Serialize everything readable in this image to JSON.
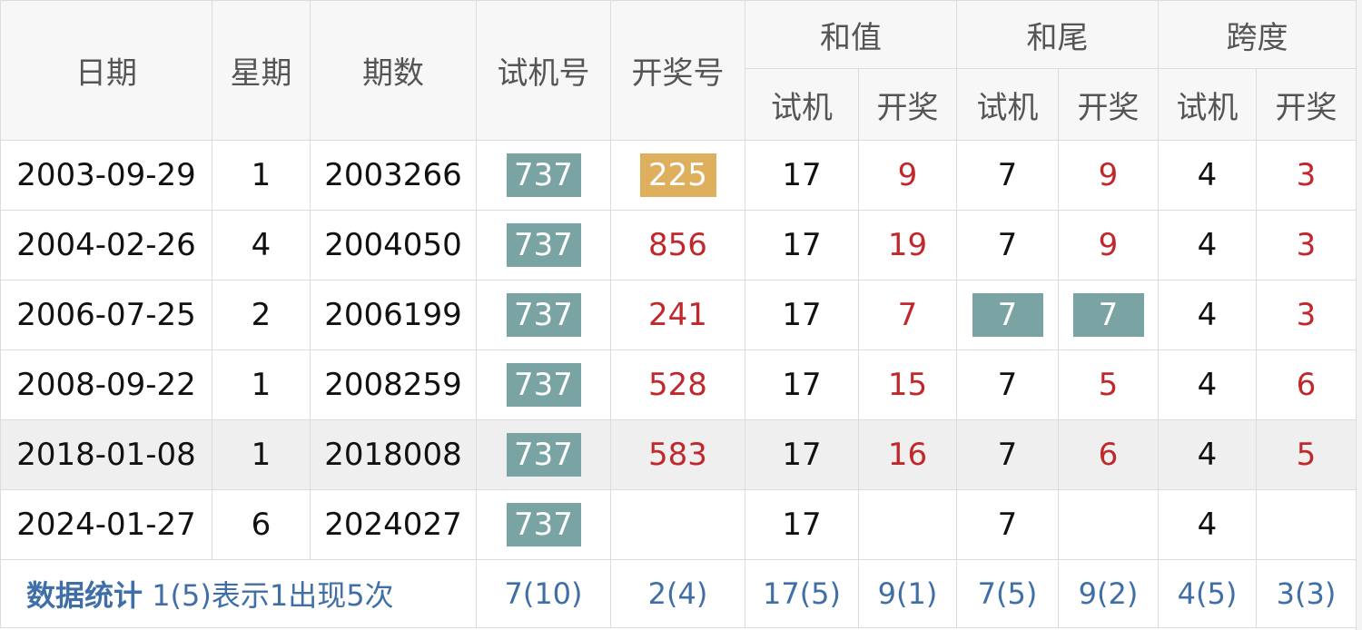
{
  "headers": {
    "date": "日期",
    "weekday": "星期",
    "issue": "期数",
    "test_number": "试机号",
    "draw_number": "开奖号",
    "sum": "和值",
    "sum_tail": "和尾",
    "span": "跨度",
    "sub_test": "试机",
    "sub_draw": "开奖"
  },
  "rows": [
    {
      "date": "2003-09-29",
      "weekday": "1",
      "issue": "2003266",
      "test": "737",
      "draw": "225",
      "sum_test": "17",
      "sum_draw": "9",
      "tail_test": "7",
      "tail_draw": "9",
      "span_test": "4",
      "span_draw": "3"
    },
    {
      "date": "2004-02-26",
      "weekday": "4",
      "issue": "2004050",
      "test": "737",
      "draw": "856",
      "sum_test": "17",
      "sum_draw": "19",
      "tail_test": "7",
      "tail_draw": "9",
      "span_test": "4",
      "span_draw": "3"
    },
    {
      "date": "2006-07-25",
      "weekday": "2",
      "issue": "2006199",
      "test": "737",
      "draw": "241",
      "sum_test": "17",
      "sum_draw": "7",
      "tail_test": "7",
      "tail_draw": "7",
      "span_test": "4",
      "span_draw": "3"
    },
    {
      "date": "2008-09-22",
      "weekday": "1",
      "issue": "2008259",
      "test": "737",
      "draw": "528",
      "sum_test": "17",
      "sum_draw": "15",
      "tail_test": "7",
      "tail_draw": "5",
      "span_test": "4",
      "span_draw": "6"
    },
    {
      "date": "2018-01-08",
      "weekday": "1",
      "issue": "2018008",
      "test": "737",
      "draw": "583",
      "sum_test": "17",
      "sum_draw": "16",
      "tail_test": "7",
      "tail_draw": "6",
      "span_test": "4",
      "span_draw": "5"
    },
    {
      "date": "2024-01-27",
      "weekday": "6",
      "issue": "2024027",
      "test": "737",
      "draw": "",
      "sum_test": "17",
      "sum_draw": "",
      "tail_test": "7",
      "tail_draw": "",
      "span_test": "4",
      "span_draw": ""
    }
  ],
  "footer": {
    "title": "数据统计",
    "note": "1(5)表示1出现5次",
    "test": "7(10)",
    "draw": "2(4)",
    "sum_test": "17(5)",
    "sum_draw": "9(1)",
    "tail_test": "7(5)",
    "tail_draw": "9(2)",
    "span_test": "4(5)",
    "span_draw": "3(3)"
  },
  "colors": {
    "badge_teal": "#7aa3a3",
    "badge_orange": "#deb05e",
    "draw_red": "#c0282b",
    "stat_blue": "#3f6fa6",
    "header_bg": "#f7f7f7",
    "highlight_row_bg": "#efefef"
  }
}
